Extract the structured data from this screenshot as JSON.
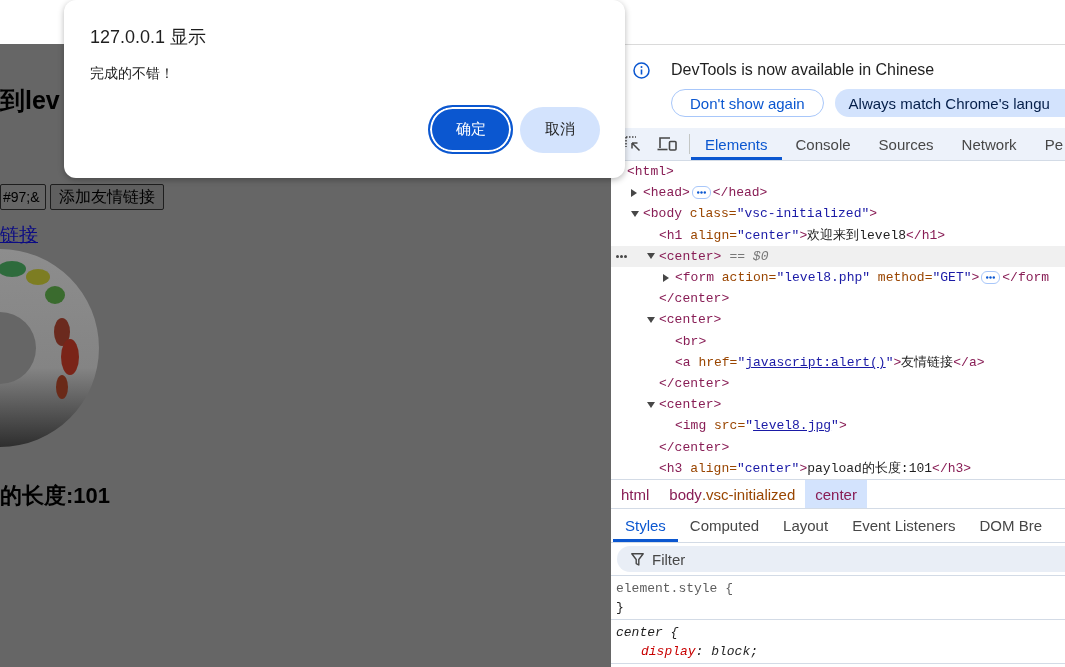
{
  "page": {
    "heading": "到lev",
    "input": {
      "value": "#97;&"
    },
    "button": "添加友情链接",
    "link": "链接",
    "subheading": "的长度:101"
  },
  "dialog": {
    "title": "127.0.0.1 显示",
    "message": "完成的不错！",
    "buttons": [
      {
        "label": "确定",
        "kind": "primary",
        "focused": true
      },
      {
        "label": "取消",
        "kind": "secondary",
        "focused": false
      }
    ]
  },
  "devtools": {
    "notice": {
      "message": "DevTools is now available in Chinese",
      "buttons": [
        {
          "label": "Don't show again",
          "kind": "outline"
        },
        {
          "label": "Always match Chrome's langu",
          "kind": "filled"
        }
      ]
    },
    "panel_tabs": [
      {
        "label": "Elements",
        "selected": true
      },
      {
        "label": "Console",
        "selected": false
      },
      {
        "label": "Sources",
        "selected": false
      },
      {
        "label": "Network",
        "selected": false
      },
      {
        "label": "Pe",
        "selected": false
      }
    ],
    "dom_tree": [
      {
        "tokens": [
          {
            "kind": "tag",
            "text": "<html>"
          }
        ],
        "selected": false,
        "children": [
          {
            "tokens": [
              {
                "kind": "tag",
                "text": "<head>"
              }
            ],
            "expanded": false,
            "close": "</head>",
            "selected": false
          },
          {
            "tokens": [
              {
                "kind": "tag",
                "text": "<body"
              },
              {
                "kind": "attr",
                "text": " class="
              },
              {
                "kind": "value",
                "text": "\"vsc-initialized\""
              },
              {
                "kind": "tag",
                "text": ">"
              }
            ],
            "expanded": true,
            "selected": false,
            "children": [
              {
                "tokens": [
                  {
                    "kind": "tag",
                    "text": "<h1"
                  },
                  {
                    "kind": "attr",
                    "text": " align="
                  },
                  {
                    "kind": "value",
                    "text": "\"center\""
                  },
                  {
                    "kind": "tag",
                    "text": ">"
                  },
                  {
                    "kind": "text",
                    "text": "欢迎来到level8"
                  },
                  {
                    "kind": "tag",
                    "text": "</h1>"
                  }
                ],
                "selected": false
              },
              {
                "tokens": [
                  {
                    "kind": "tag",
                    "text": "<center>"
                  },
                  {
                    "kind": "note",
                    "text": "== $0"
                  }
                ],
                "expanded": true,
                "selected": true,
                "close": "</center>",
                "children": [
                  {
                    "tokens": [
                      {
                        "kind": "tag",
                        "text": "<form"
                      },
                      {
                        "kind": "attr",
                        "text": " action="
                      },
                      {
                        "kind": "value",
                        "text": "\"level8.php\""
                      },
                      {
                        "kind": "attr",
                        "text": " method="
                      },
                      {
                        "kind": "value",
                        "text": "\"GET\""
                      },
                      {
                        "kind": "tag",
                        "text": ">"
                      }
                    ],
                    "expanded": false,
                    "close": "</form",
                    "selected": false
                  }
                ]
              },
              {
                "tokens": [
                  {
                    "kind": "tag",
                    "text": "<center>"
                  }
                ],
                "expanded": true,
                "selected": false,
                "close": "</center>",
                "children": [
                  {
                    "tokens": [
                      {
                        "kind": "tag",
                        "text": "<br>"
                      }
                    ],
                    "selected": false
                  },
                  {
                    "tokens": [
                      {
                        "kind": "tag",
                        "text": "<a"
                      },
                      {
                        "kind": "attr",
                        "text": " href="
                      },
                      {
                        "kind": "value",
                        "text": "\""
                      },
                      {
                        "kind": "link",
                        "text": "javascript:alert()"
                      },
                      {
                        "kind": "value",
                        "text": "\""
                      },
                      {
                        "kind": "tag",
                        "text": ">"
                      },
                      {
                        "kind": "text",
                        "text": "友情链接"
                      },
                      {
                        "kind": "tag",
                        "text": "</a>"
                      }
                    ],
                    "selected": false
                  }
                ]
              },
              {
                "tokens": [
                  {
                    "kind": "tag",
                    "text": "<center>"
                  }
                ],
                "expanded": true,
                "selected": false,
                "close": "</center>",
                "children": [
                  {
                    "tokens": [
                      {
                        "kind": "tag",
                        "text": "<img"
                      },
                      {
                        "kind": "attr",
                        "text": " src="
                      },
                      {
                        "kind": "value",
                        "text": "\""
                      },
                      {
                        "kind": "link",
                        "text": "level8.jpg"
                      },
                      {
                        "kind": "value",
                        "text": "\""
                      },
                      {
                        "kind": "tag",
                        "text": ">"
                      }
                    ],
                    "selected": false
                  }
                ]
              },
              {
                "tokens": [
                  {
                    "kind": "tag",
                    "text": "<h3"
                  },
                  {
                    "kind": "attr",
                    "text": " align="
                  },
                  {
                    "kind": "value",
                    "text": "\"center\""
                  },
                  {
                    "kind": "tag",
                    "text": ">"
                  },
                  {
                    "kind": "text",
                    "text": "payload的长度:101"
                  },
                  {
                    "kind": "tag",
                    "text": "</h3>"
                  }
                ],
                "selected": false
              }
            ]
          }
        ]
      }
    ],
    "breadcrumbs": [
      {
        "tokens": [
          {
            "kind": "tag",
            "text": "html"
          }
        ],
        "selected": false
      },
      {
        "tokens": [
          {
            "kind": "tag",
            "text": "body"
          },
          {
            "kind": "attr",
            "text": ".vsc-initialized"
          }
        ],
        "selected": false
      },
      {
        "tokens": [
          {
            "kind": "tag",
            "text": "center"
          }
        ],
        "selected": true
      }
    ],
    "sidebar_tabs": [
      {
        "label": "Styles",
        "selected": true
      },
      {
        "label": "Computed",
        "selected": false
      },
      {
        "label": "Layout",
        "selected": false
      },
      {
        "label": "Event Listeners",
        "selected": false
      },
      {
        "label": "DOM Bre",
        "selected": false
      }
    ],
    "filter": {
      "placeholder": "Filter"
    },
    "rules": [
      {
        "kind": "inline",
        "selector": "element.style {",
        "close": "}"
      },
      {
        "kind": "user-agent",
        "selector": "center {",
        "declarations": [
          [
            {
              "kind": "prop",
              "text": "display"
            },
            {
              "kind": "plain",
              "text": ": block;"
            }
          ]
        ]
      }
    ]
  }
}
